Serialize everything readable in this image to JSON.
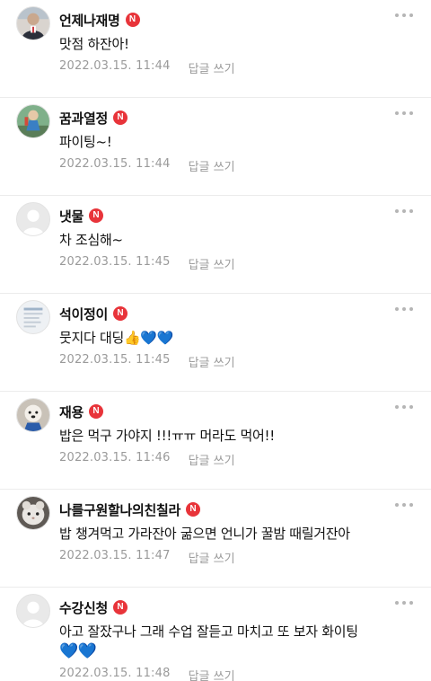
{
  "comments": [
    {
      "nickname": "언제나재명",
      "badge": "N",
      "text": "맛점 하잔아!",
      "date": "2022.03.15. 11:44",
      "reply": "답글 쓰기",
      "avatar": "avatar-photo-person"
    },
    {
      "nickname": "꿈과열정",
      "badge": "N",
      "text": "파이팅~!",
      "date": "2022.03.15. 11:44",
      "reply": "답글 쓰기",
      "avatar": "avatar-photo-figure"
    },
    {
      "nickname": "냇물",
      "badge": "N",
      "text": "차 조심해~",
      "date": "2022.03.15. 11:45",
      "reply": "답글 쓰기",
      "avatar": "avatar-default"
    },
    {
      "nickname": "석이정이",
      "badge": "N",
      "text": "뭇지다 대딩",
      "emoji": "👍💙💙",
      "date": "2022.03.15. 11:45",
      "reply": "답글 쓰기",
      "avatar": "avatar-photo-document"
    },
    {
      "nickname": "재용",
      "badge": "N",
      "text": "밥은 먹구 가야지 !!!ㅠㅠ 머라도 먹어!!",
      "date": "2022.03.15. 11:46",
      "reply": "답글 쓰기",
      "avatar": "avatar-photo-dog"
    },
    {
      "nickname": "나를구원할나의친칠라",
      "badge": "N",
      "text": "밥 챙겨먹고 가라잔아 굶으면 언니가 꿀밤 때릴거잔아",
      "date": "2022.03.15. 11:47",
      "reply": "답글 쓰기",
      "avatar": "avatar-photo-chinchilla"
    },
    {
      "nickname": "수강신청",
      "badge": "N",
      "text": "아고 잘잤구나 그래 수업 잘듣고 마치고 또 보자 화이팅",
      "emoji": "💙💙",
      "date": "2022.03.15. 11:48",
      "reply": "답글 쓰기",
      "avatar": "avatar-default"
    }
  ],
  "colors": {
    "badge": "#e8343a",
    "meta": "#9a9a9a",
    "heart": "#1e7ef0"
  }
}
